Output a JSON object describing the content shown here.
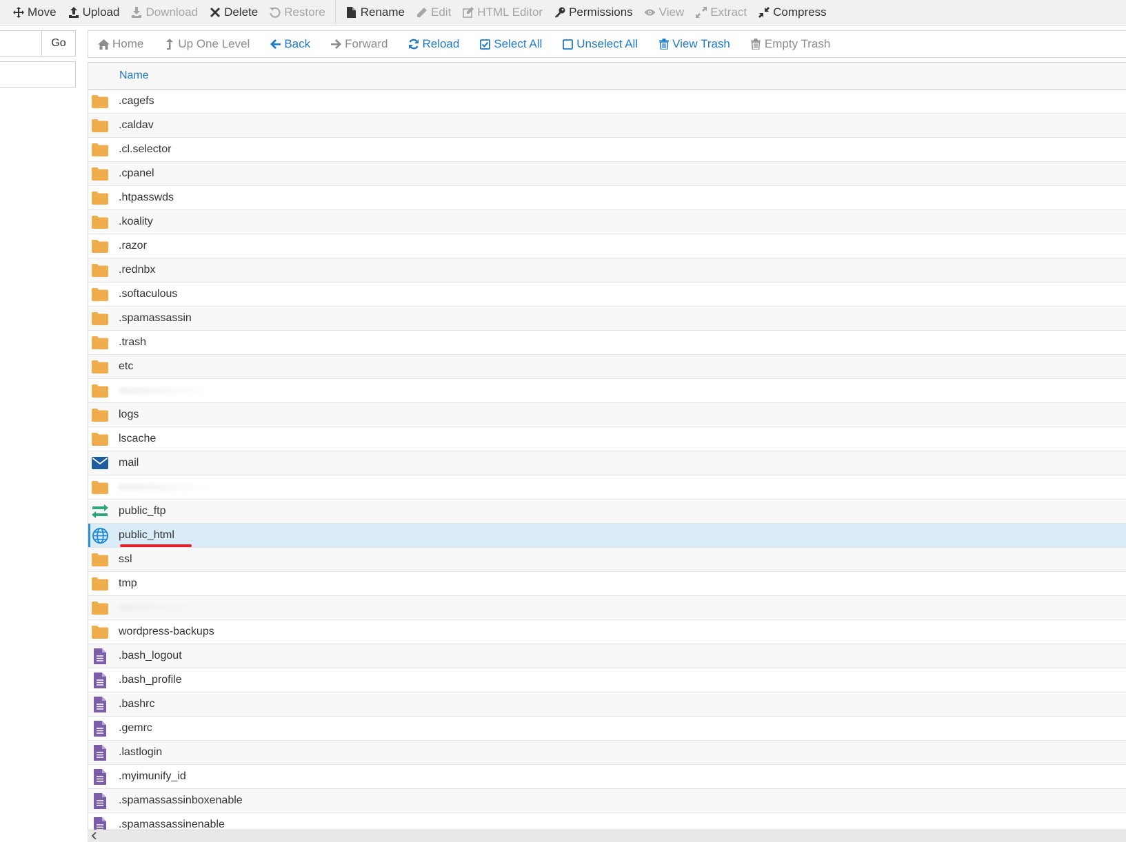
{
  "toolbar": {
    "items": [
      {
        "label": "Move",
        "icon": "move-icon",
        "enabled": true
      },
      {
        "label": "Upload",
        "icon": "upload-icon",
        "enabled": true
      },
      {
        "label": "Download",
        "icon": "download-icon",
        "enabled": false
      },
      {
        "label": "Delete",
        "icon": "delete-icon",
        "enabled": true
      },
      {
        "label": "Restore",
        "icon": "restore-icon",
        "enabled": false
      },
      {
        "label": "Rename",
        "icon": "rename-icon",
        "enabled": true
      },
      {
        "label": "Edit",
        "icon": "edit-icon",
        "enabled": false
      },
      {
        "label": "HTML Editor",
        "icon": "html-editor-icon",
        "enabled": false
      },
      {
        "label": "Permissions",
        "icon": "key-icon",
        "enabled": true
      },
      {
        "label": "View",
        "icon": "eye-icon",
        "enabled": false
      },
      {
        "label": "Extract",
        "icon": "extract-icon",
        "enabled": false
      },
      {
        "label": "Compress",
        "icon": "compress-icon",
        "enabled": true
      }
    ]
  },
  "sidebar": {
    "path_value": "",
    "go_label": "Go"
  },
  "nav": {
    "items": [
      {
        "label": "Home",
        "icon": "home-icon",
        "enabled": false
      },
      {
        "label": "Up One Level",
        "icon": "level-up-icon",
        "enabled": false
      },
      {
        "label": "Back",
        "icon": "back-arrow-icon",
        "enabled": true
      },
      {
        "label": "Forward",
        "icon": "forward-arrow-icon",
        "enabled": false
      },
      {
        "label": "Reload",
        "icon": "reload-icon",
        "enabled": true
      },
      {
        "label": "Select All",
        "icon": "checked-box-icon",
        "enabled": true
      },
      {
        "label": "Unselect All",
        "icon": "empty-box-icon",
        "enabled": true
      },
      {
        "label": "View Trash",
        "icon": "trash-icon",
        "enabled": true
      },
      {
        "label": "Empty Trash",
        "icon": "trash-icon",
        "enabled": false
      }
    ]
  },
  "table": {
    "column_name": "Name",
    "rows": [
      {
        "name": ".cagefs",
        "type": "folder"
      },
      {
        "name": ".caldav",
        "type": "folder"
      },
      {
        "name": ".cl.selector",
        "type": "folder"
      },
      {
        "name": ".cpanel",
        "type": "folder"
      },
      {
        "name": ".htpasswds",
        "type": "folder"
      },
      {
        "name": ".koality",
        "type": "folder"
      },
      {
        "name": ".razor",
        "type": "folder"
      },
      {
        "name": ".rednbx",
        "type": "folder"
      },
      {
        "name": ".softaculous",
        "type": "folder"
      },
      {
        "name": ".spamassassin",
        "type": "folder"
      },
      {
        "name": ".trash",
        "type": "folder"
      },
      {
        "name": "etc",
        "type": "folder"
      },
      {
        "name": "",
        "type": "folder",
        "blurred": true
      },
      {
        "name": "logs",
        "type": "folder"
      },
      {
        "name": "lscache",
        "type": "folder"
      },
      {
        "name": "mail",
        "type": "mail"
      },
      {
        "name": "",
        "type": "folder",
        "blurred": true
      },
      {
        "name": "public_ftp",
        "type": "ftp"
      },
      {
        "name": "public_html",
        "type": "web",
        "selected": true,
        "underlined": true
      },
      {
        "name": "ssl",
        "type": "folder"
      },
      {
        "name": "tmp",
        "type": "folder"
      },
      {
        "name": "",
        "type": "folder",
        "blurred": true
      },
      {
        "name": "wordpress-backups",
        "type": "folder"
      },
      {
        "name": ".bash_logout",
        "type": "file"
      },
      {
        "name": ".bash_profile",
        "type": "file"
      },
      {
        "name": ".bashrc",
        "type": "file"
      },
      {
        "name": ".gemrc",
        "type": "file"
      },
      {
        "name": ".lastlogin",
        "type": "file"
      },
      {
        "name": ".myimunify_id",
        "type": "file"
      },
      {
        "name": ".spamassassinboxenable",
        "type": "file"
      },
      {
        "name": ".spamassassinenable",
        "type": "file"
      }
    ]
  },
  "colors": {
    "folder": "#f0ad4e",
    "link": "#1f7ac8",
    "mail": "#1f5e9e",
    "ftp": "#2aa876",
    "web": "#1e88d8",
    "file": "#7b5ea7",
    "selected_row": "#d9ecf8",
    "annotation_underline": "#e0212b"
  }
}
